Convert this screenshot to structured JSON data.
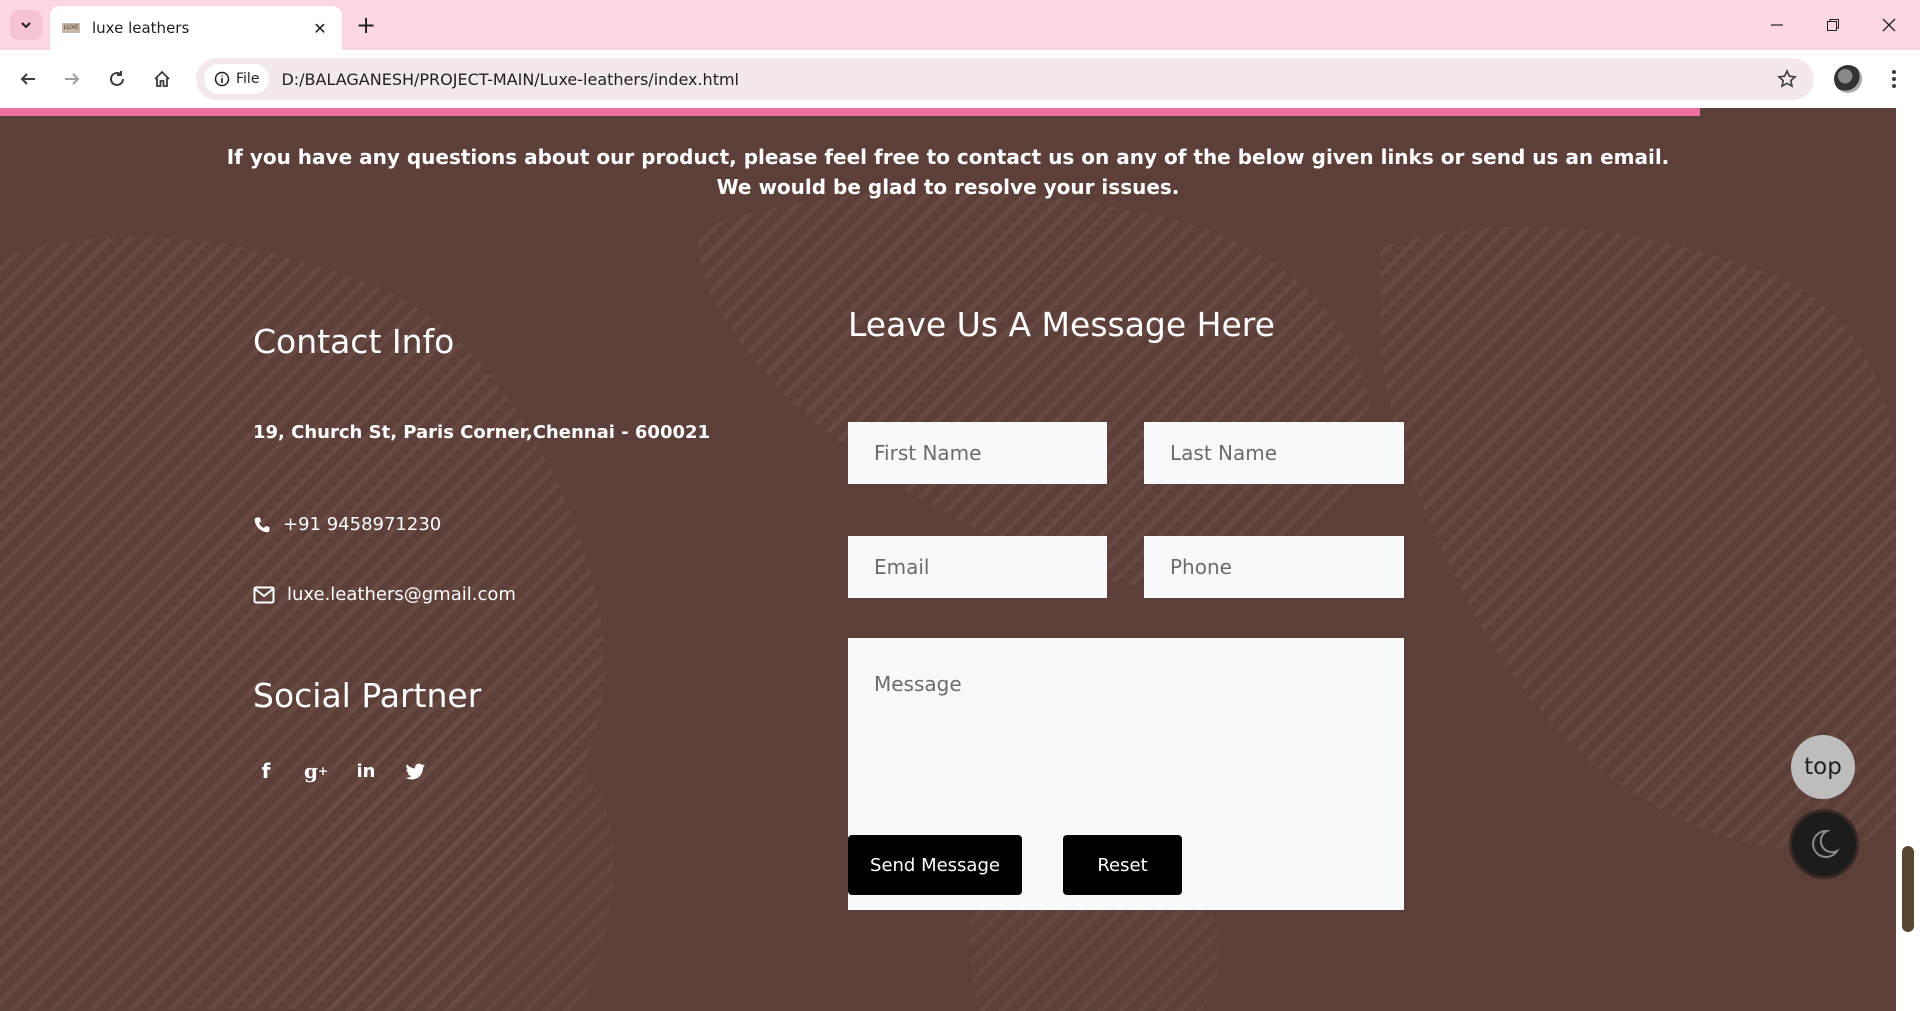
{
  "browser": {
    "tab_title": "luxe leathers",
    "favicon_text": "LUXE",
    "file_chip": "File",
    "url": "D:/BALAGANESH/PROJECT-MAIN/Luxe-leathers/index.html"
  },
  "intro": {
    "line1": "If you have any questions about our product, please feel free to contact us on any of the below given links or send us an email.",
    "line2": "We would be glad to resolve your issues."
  },
  "contact": {
    "heading": "Contact Info",
    "address": "19, Church St, Paris Corner,Chennai - 600021",
    "phone": "+91 9458971230",
    "email": "luxe.leathers@gmail.com"
  },
  "social": {
    "heading": "Social Partner",
    "icons": [
      "facebook-icon",
      "google-plus-icon",
      "linkedin-icon",
      "twitter-icon"
    ]
  },
  "form": {
    "heading": "Leave Us A Message Here",
    "first_name_placeholder": "First Name",
    "last_name_placeholder": "Last Name",
    "email_placeholder": "Email",
    "phone_placeholder": "Phone",
    "message_placeholder": "Message",
    "send_label": "Send Message",
    "reset_label": "Reset"
  },
  "floating": {
    "top_label": "top"
  },
  "colors": {
    "page_bg": "#5c3f38",
    "accent_pink": "#ef6fa3",
    "tabbar_bg": "#fdd7e1"
  }
}
